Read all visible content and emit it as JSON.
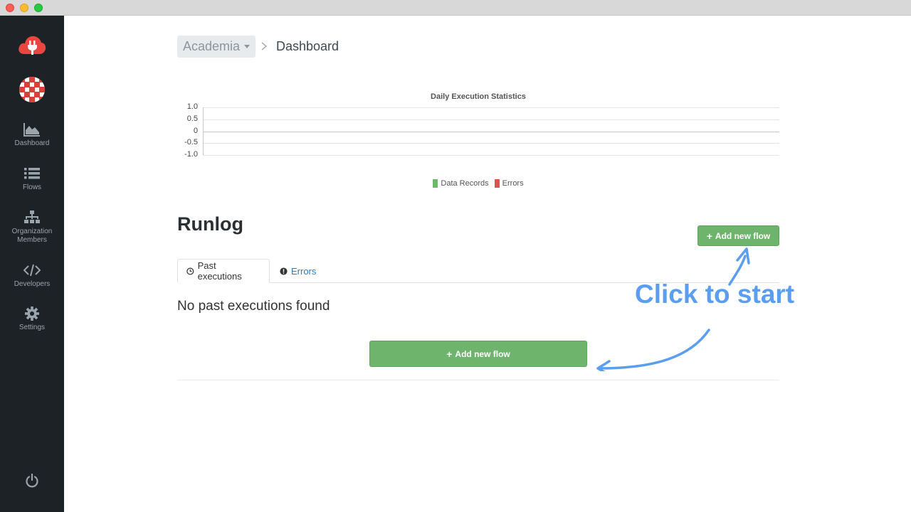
{
  "window": {
    "controls": [
      "close",
      "minimize",
      "maximize"
    ]
  },
  "sidebar": {
    "logo_icon": "cloud-plug-icon",
    "avatar_icon": "org-avatar-icon",
    "items": [
      {
        "label": "Dashboard",
        "icon": "area-chart-icon"
      },
      {
        "label": "Flows",
        "icon": "list-icon"
      },
      {
        "label": "Organization Members",
        "icon": "sitemap-icon"
      },
      {
        "label": "Developers",
        "icon": "code-icon"
      },
      {
        "label": "Settings",
        "icon": "gear-icon"
      }
    ],
    "power_icon": "power-icon"
  },
  "breadcrumb": {
    "org": "Academia",
    "current": "Dashboard"
  },
  "chart_data": {
    "type": "bar",
    "title": "Daily Execution Statistics",
    "xlabel": "",
    "ylabel": "",
    "categories": [],
    "series": [
      {
        "name": "Data Records",
        "values": [],
        "color": "#6cb96a"
      },
      {
        "name": "Errors",
        "values": [],
        "color": "#d9534f"
      }
    ],
    "ylim": [
      -1.0,
      1.0
    ],
    "yticks": [
      "1.0",
      "0.5",
      "0",
      "-0.5",
      "-1.0"
    ],
    "legend": "bottom",
    "grid": true
  },
  "runlog": {
    "title": "Runlog",
    "add_button_label": "Add new flow",
    "tabs": [
      {
        "label": "Past executions",
        "icon": "clock-icon",
        "active": true
      },
      {
        "label": "Errors",
        "icon": "exclamation-circle-icon",
        "active": false
      }
    ],
    "empty_message": "No past executions found",
    "add_button_big_label": "Add new flow"
  },
  "annotation": {
    "text": "Click to start",
    "color": "#5b9ef0"
  },
  "colors": {
    "sidebar_bg": "#1d2226",
    "brand_red": "#e8463f",
    "button_green": "#6fb46c",
    "link_blue": "#2c7bc0"
  }
}
